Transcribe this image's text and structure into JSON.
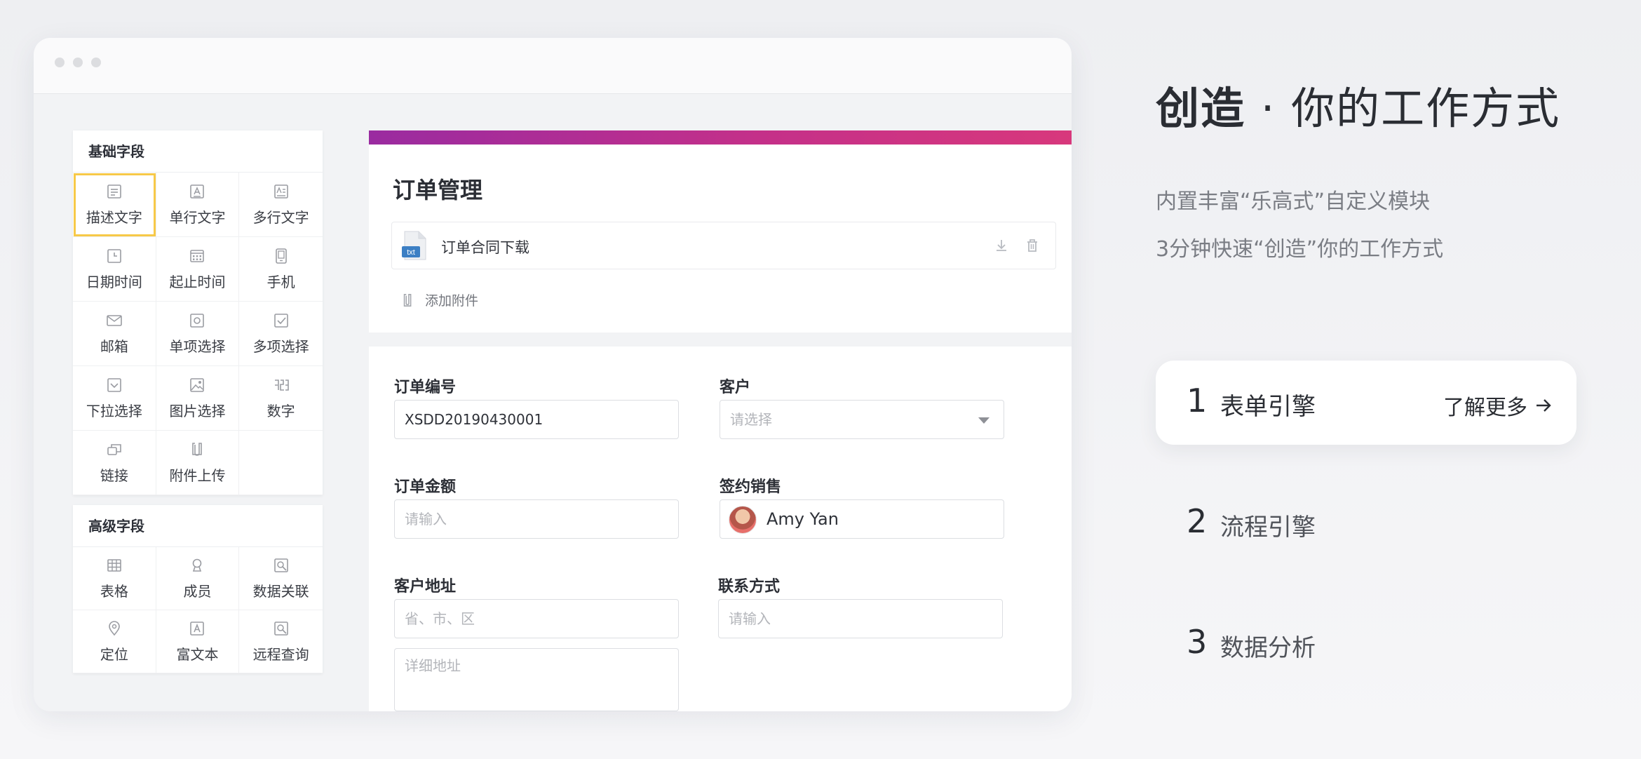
{
  "palette": {
    "basic_title": "基础字段",
    "basic_items": [
      {
        "label": "描述文字",
        "icon": "description-icon"
      },
      {
        "label": "单行文字",
        "icon": "single-line-text-icon"
      },
      {
        "label": "多行文字",
        "icon": "multi-line-text-icon"
      },
      {
        "label": "日期时间",
        "icon": "date-time-icon"
      },
      {
        "label": "起止时间",
        "icon": "date-range-icon"
      },
      {
        "label": "手机",
        "icon": "phone-icon"
      },
      {
        "label": "邮箱",
        "icon": "mail-icon"
      },
      {
        "label": "单项选择",
        "icon": "radio-icon"
      },
      {
        "label": "多项选择",
        "icon": "checkbox-icon"
      },
      {
        "label": "下拉选择",
        "icon": "dropdown-icon"
      },
      {
        "label": "图片选择",
        "icon": "image-icon"
      },
      {
        "label": "数字",
        "icon": "number-icon"
      },
      {
        "label": "链接",
        "icon": "link-icon"
      },
      {
        "label": "附件上传",
        "icon": "attachment-icon"
      }
    ],
    "adv_title": "高级字段",
    "adv_items": [
      {
        "label": "表格",
        "icon": "table-icon"
      },
      {
        "label": "成员",
        "icon": "member-icon"
      },
      {
        "label": "数据关联",
        "icon": "data-link-icon"
      },
      {
        "label": "定位",
        "icon": "location-icon"
      },
      {
        "label": "富文本",
        "icon": "rich-text-icon"
      },
      {
        "label": "远程查询",
        "icon": "remote-query-icon"
      }
    ]
  },
  "form": {
    "accent_gradient": [
      "#9a2ba0",
      "#d8387c"
    ],
    "title": "订单管理",
    "attachment": {
      "file_type": "txt",
      "name": "订单合同下载"
    },
    "add_attachment": "添加附件",
    "fields": {
      "order_no": {
        "label": "订单编号",
        "value": "XSDD20190430001"
      },
      "customer": {
        "label": "客户",
        "placeholder": "请选择"
      },
      "amount": {
        "label": "订单金额",
        "placeholder": "请输入"
      },
      "sales": {
        "label": "签约销售",
        "value": "Amy Yan"
      },
      "address": {
        "label": "客户地址",
        "placeholder": "省、市、区",
        "detail_placeholder": "详细地址"
      },
      "contact": {
        "label": "联系方式",
        "placeholder": "请输入"
      }
    }
  },
  "hero": {
    "title_strong": "创造",
    "title_sep": " · ",
    "title_rest": "你的工作方式",
    "line1": "内置丰富“乐高式”自定义模块",
    "line2": "3分钟快速“创造”你的工作方式"
  },
  "features": [
    {
      "num": "1",
      "name": "表单引擎",
      "more": "了解更多"
    },
    {
      "num": "2",
      "name": "流程引擎"
    },
    {
      "num": "3",
      "name": "数据分析"
    }
  ]
}
